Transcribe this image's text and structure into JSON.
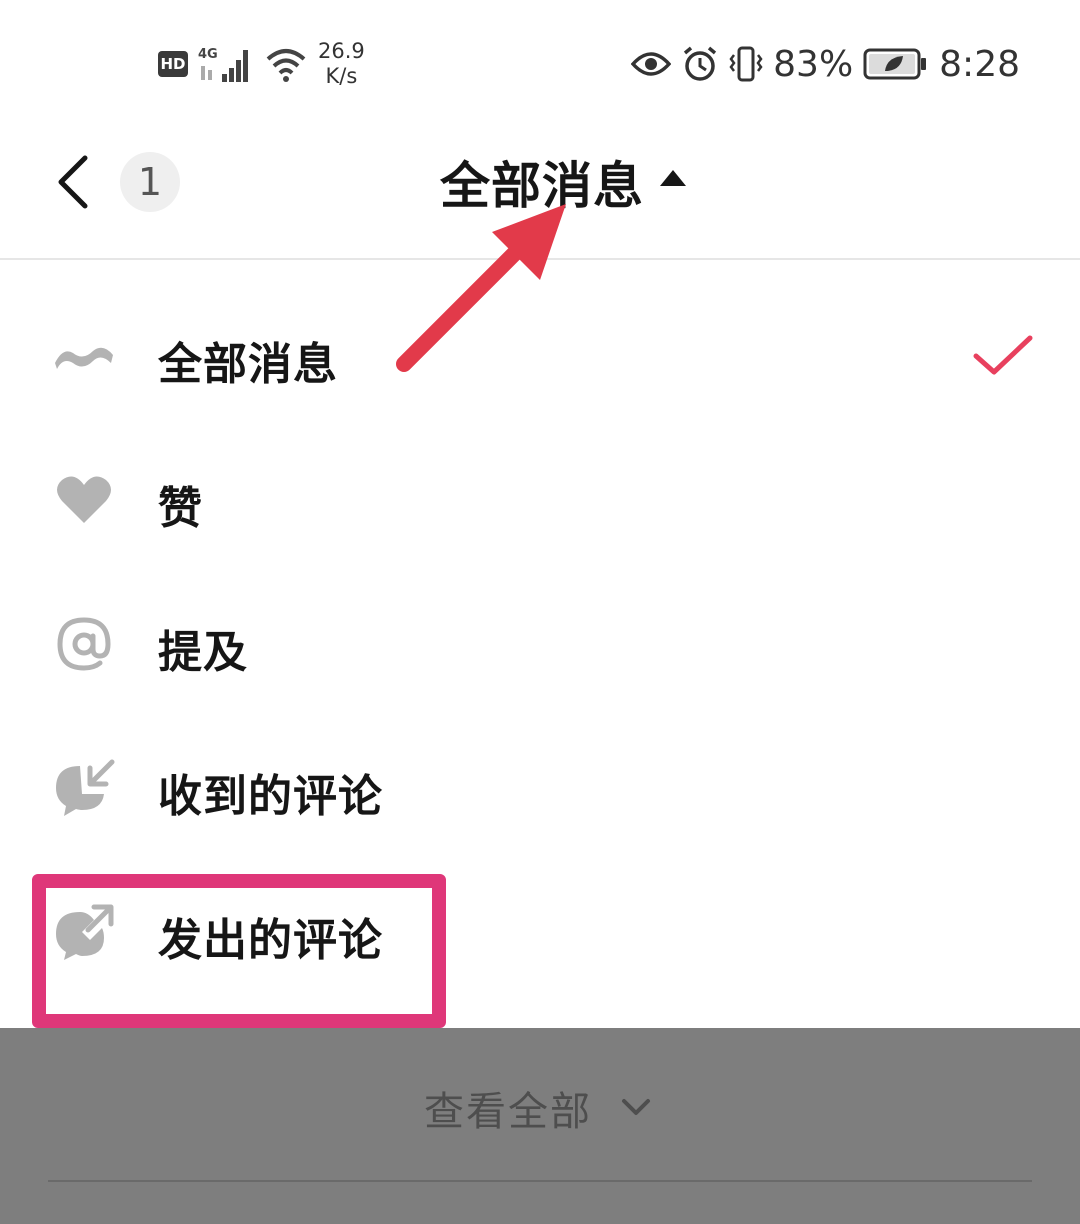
{
  "status_bar": {
    "hd": "HD",
    "net_speed_value": "26.9",
    "net_speed_unit": "K/s",
    "battery": "83%",
    "time": "8:28"
  },
  "header": {
    "count": "1",
    "title": "全部消息"
  },
  "menu": {
    "items": [
      {
        "label": "全部消息",
        "icon": "wave-icon",
        "selected": true
      },
      {
        "label": "赞",
        "icon": "heart-icon",
        "selected": false
      },
      {
        "label": "提及",
        "icon": "at-icon",
        "selected": false
      },
      {
        "label": "收到的评论",
        "icon": "comment-received-icon",
        "selected": false
      },
      {
        "label": "发出的评论",
        "icon": "comment-sent-icon",
        "selected": false
      }
    ]
  },
  "footer": {
    "view_all": "查看全部"
  },
  "colors": {
    "accent": "#e8405e",
    "highlight": "#df3779",
    "annotation_arrow": "#e23a4a",
    "icon_gray": "#b3b3b3",
    "overlay": "#7e7e7e"
  }
}
